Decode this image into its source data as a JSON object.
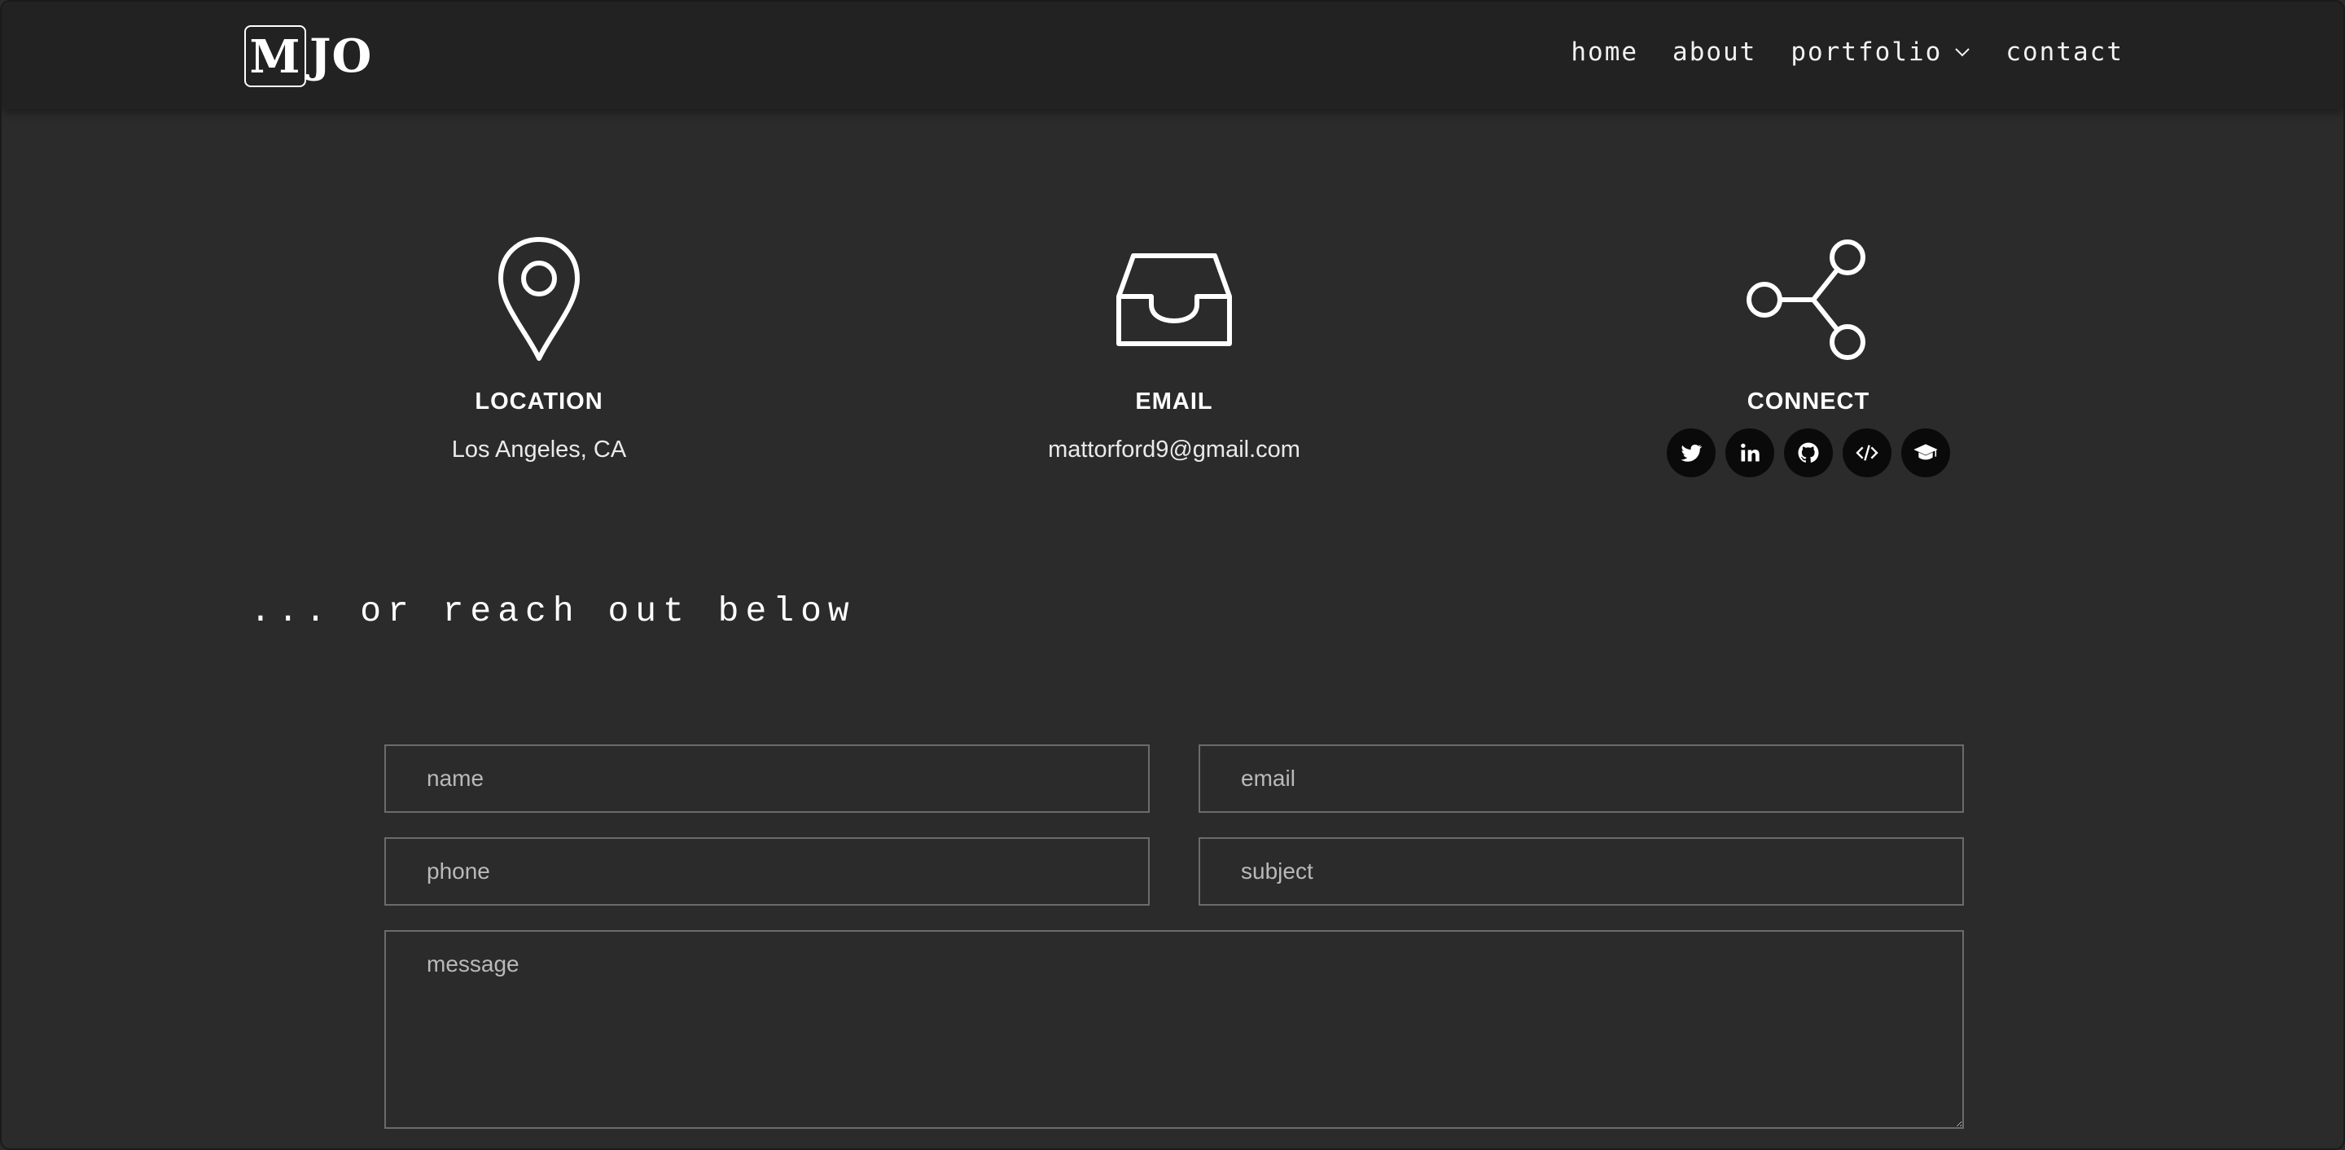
{
  "header": {
    "logo": {
      "boxed_letter": "M",
      "rest": "JO"
    },
    "nav": [
      {
        "label": "home"
      },
      {
        "label": "about"
      },
      {
        "label": "portfolio"
      },
      {
        "label": "contact"
      }
    ]
  },
  "contact": {
    "location": {
      "title": "LOCATION",
      "value": "Los Angeles, CA",
      "icon": "map-pin-icon"
    },
    "email": {
      "title": "EMAIL",
      "value": "mattorford9@gmail.com",
      "icon": "inbox-icon"
    },
    "connect": {
      "title": "CONNECT",
      "icon": "share-icon",
      "socials": [
        "twitter-icon",
        "linkedin-icon",
        "github-icon",
        "code-icon",
        "graduation-cap-icon"
      ]
    }
  },
  "reach_heading": "... or reach out below",
  "form": {
    "name_placeholder": "name",
    "email_placeholder": "email",
    "phone_placeholder": "phone",
    "subject_placeholder": "subject",
    "message_placeholder": "message"
  }
}
